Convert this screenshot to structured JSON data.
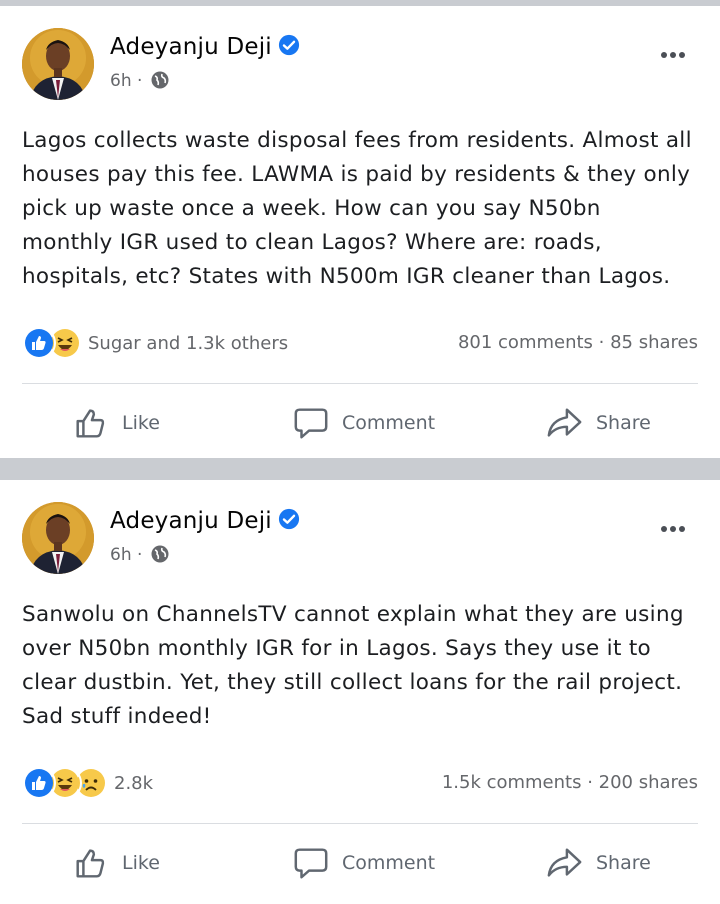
{
  "posts": [
    {
      "author": "Adeyanju Deji",
      "time": "6h",
      "text": "Lagos collects waste disposal fees from residents. Almost all houses pay this fee. LAWMA is paid by residents & they only pick up waste once a week. How can you say N50bn monthly IGR used to clean Lagos? Where are: roads, hospitals, etc? States with N500m IGR cleaner than Lagos.",
      "reactions_text": "Sugar and 1.3k others",
      "reaction_icons": [
        "like-icon",
        "haha-icon"
      ],
      "counts": "801 comments · 85 shares"
    },
    {
      "author": "Adeyanju Deji",
      "time": "6h",
      "text": "Sanwolu on ChannelsTV cannot explain what they are using over N50bn monthly IGR for in Lagos. Says they use it to clear dustbin. Yet, they still collect loans for the rail project. Sad stuff indeed!",
      "reactions_text": "2.8k",
      "reaction_icons": [
        "like-icon",
        "haha-icon",
        "sad-icon"
      ],
      "counts": "1.5k comments · 200 shares"
    }
  ],
  "actions": {
    "like": "Like",
    "comment": "Comment",
    "share": "Share"
  },
  "colors": {
    "verified": "#1877f2",
    "like_blue": "#1877f2",
    "emoji_yellow": "#f7c94a",
    "divider": "#c9ccd1",
    "secondary_text": "#65676b"
  }
}
